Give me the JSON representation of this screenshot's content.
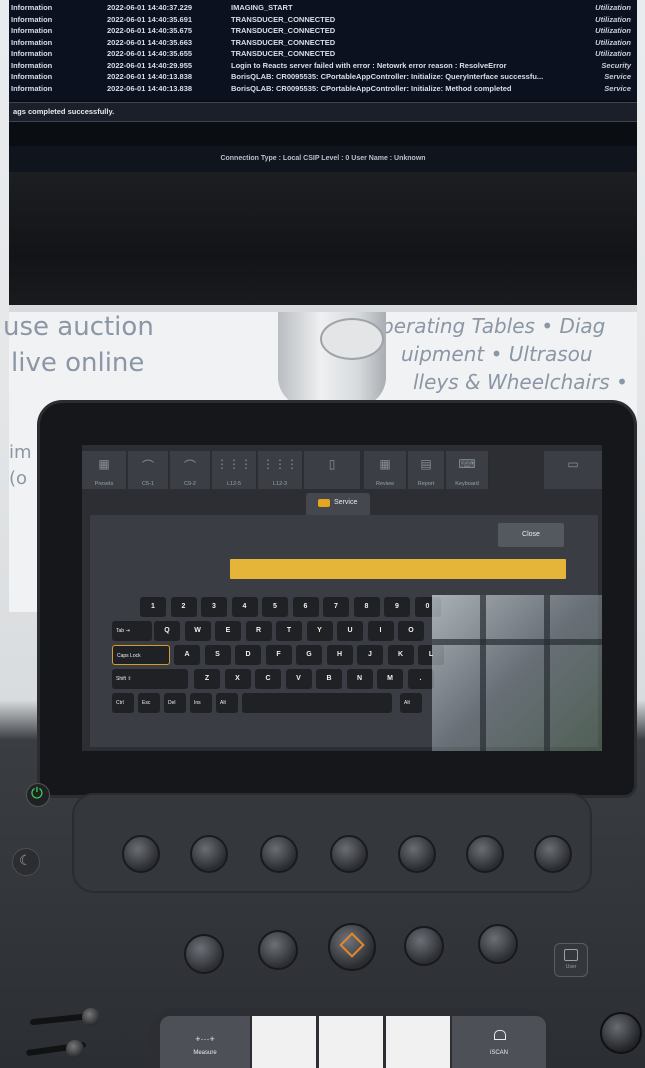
{
  "log": {
    "rows": [
      {
        "level": "Information",
        "time": "2022-06-01 14:40:37.229",
        "message": "IMAGING_START",
        "category": "Utilization"
      },
      {
        "level": "Information",
        "time": "2022-06-01 14:40:35.691",
        "message": "TRANSDUCER_CONNECTED",
        "category": "Utilization"
      },
      {
        "level": "Information",
        "time": "2022-06-01 14:40:35.675",
        "message": "TRANSDUCER_CONNECTED",
        "category": "Utilization"
      },
      {
        "level": "Information",
        "time": "2022-06-01 14:40:35.663",
        "message": "TRANSDUCER_CONNECTED",
        "category": "Utilization"
      },
      {
        "level": "Information",
        "time": "2022-06-01 14:40:35.655",
        "message": "TRANSDUCER_CONNECTED",
        "category": "Utilization"
      },
      {
        "level": "Information",
        "time": "2022-06-01 14:40:29.955",
        "message": "Login to Reacts server failed with error : Netowrk error reason : ResolveError",
        "category": "Security"
      },
      {
        "level": "Information",
        "time": "2022-06-01 14:40:13.838",
        "message": "BorisQLAB: CR0095535: CPortableAppController: Initialize: QueryInterface successfu...",
        "category": "Service"
      },
      {
        "level": "Information",
        "time": "2022-06-01 14:40:13.838",
        "message": "BorisQLAB: CR0095535: CPortableAppController: Initialize: Method completed",
        "category": "Service"
      }
    ],
    "status_message": "ags completed successfully.",
    "connection": "Connection Type : Local   CSIP Level : 0   User Name : Unknown"
  },
  "banner": {
    "line1_left": "use auction",
    "line2_left": "live online",
    "line1_right": "perating Tables • Diag",
    "line2_right": "uipment • Ultrasou",
    "line3_right": "lleys & Wheelchairs •",
    "left_edge_1": "im",
    "left_edge_2": "(o"
  },
  "touchscreen": {
    "toolbar": [
      {
        "label": "Presets",
        "icon": "presets-icon"
      },
      {
        "label": "C5-1",
        "icon": "curved-probe-icon"
      },
      {
        "label": "C9-2",
        "icon": "curved-probe-icon"
      },
      {
        "label": "L12-5",
        "icon": "linear-probe-icon"
      },
      {
        "label": "L12-3",
        "icon": "linear-probe-icon"
      },
      {
        "label": "",
        "icon": "probe-icon"
      },
      {
        "label": "Review",
        "icon": "review-icon"
      },
      {
        "label": "Report",
        "icon": "report-icon"
      },
      {
        "label": "Keyboard",
        "icon": "keyboard-icon"
      },
      {
        "label": "",
        "icon": "end-exam-icon"
      }
    ],
    "tab_label": "Service",
    "close_label": "Close",
    "input_value": "",
    "keyboard": {
      "row1": [
        "1",
        "2",
        "3",
        "4",
        "5",
        "6",
        "7",
        "8",
        "9",
        "0"
      ],
      "row2": [
        "Q",
        "W",
        "E",
        "R",
        "T",
        "Y",
        "U",
        "I",
        "O"
      ],
      "row3": [
        "A",
        "S",
        "D",
        "F",
        "G",
        "H",
        "J",
        "K",
        "L"
      ],
      "row4": [
        "Z",
        "X",
        "C",
        "V",
        "B",
        "N",
        "M",
        "."
      ],
      "tab_label": "Tab ⇥",
      "caps_label": "Caps Lock",
      "shift_label": "Shift ⇧",
      "bottom": [
        "Ctrl",
        "Esc",
        "Del",
        "Ins",
        "Alt",
        "Alt"
      ]
    }
  },
  "controls": {
    "measure_label": "Measure",
    "measure_dots": "+···+",
    "iscan_label": "iSCAN",
    "user_label": "User",
    "power_color": "#3ddc55",
    "accent_color": "#e7852a"
  }
}
